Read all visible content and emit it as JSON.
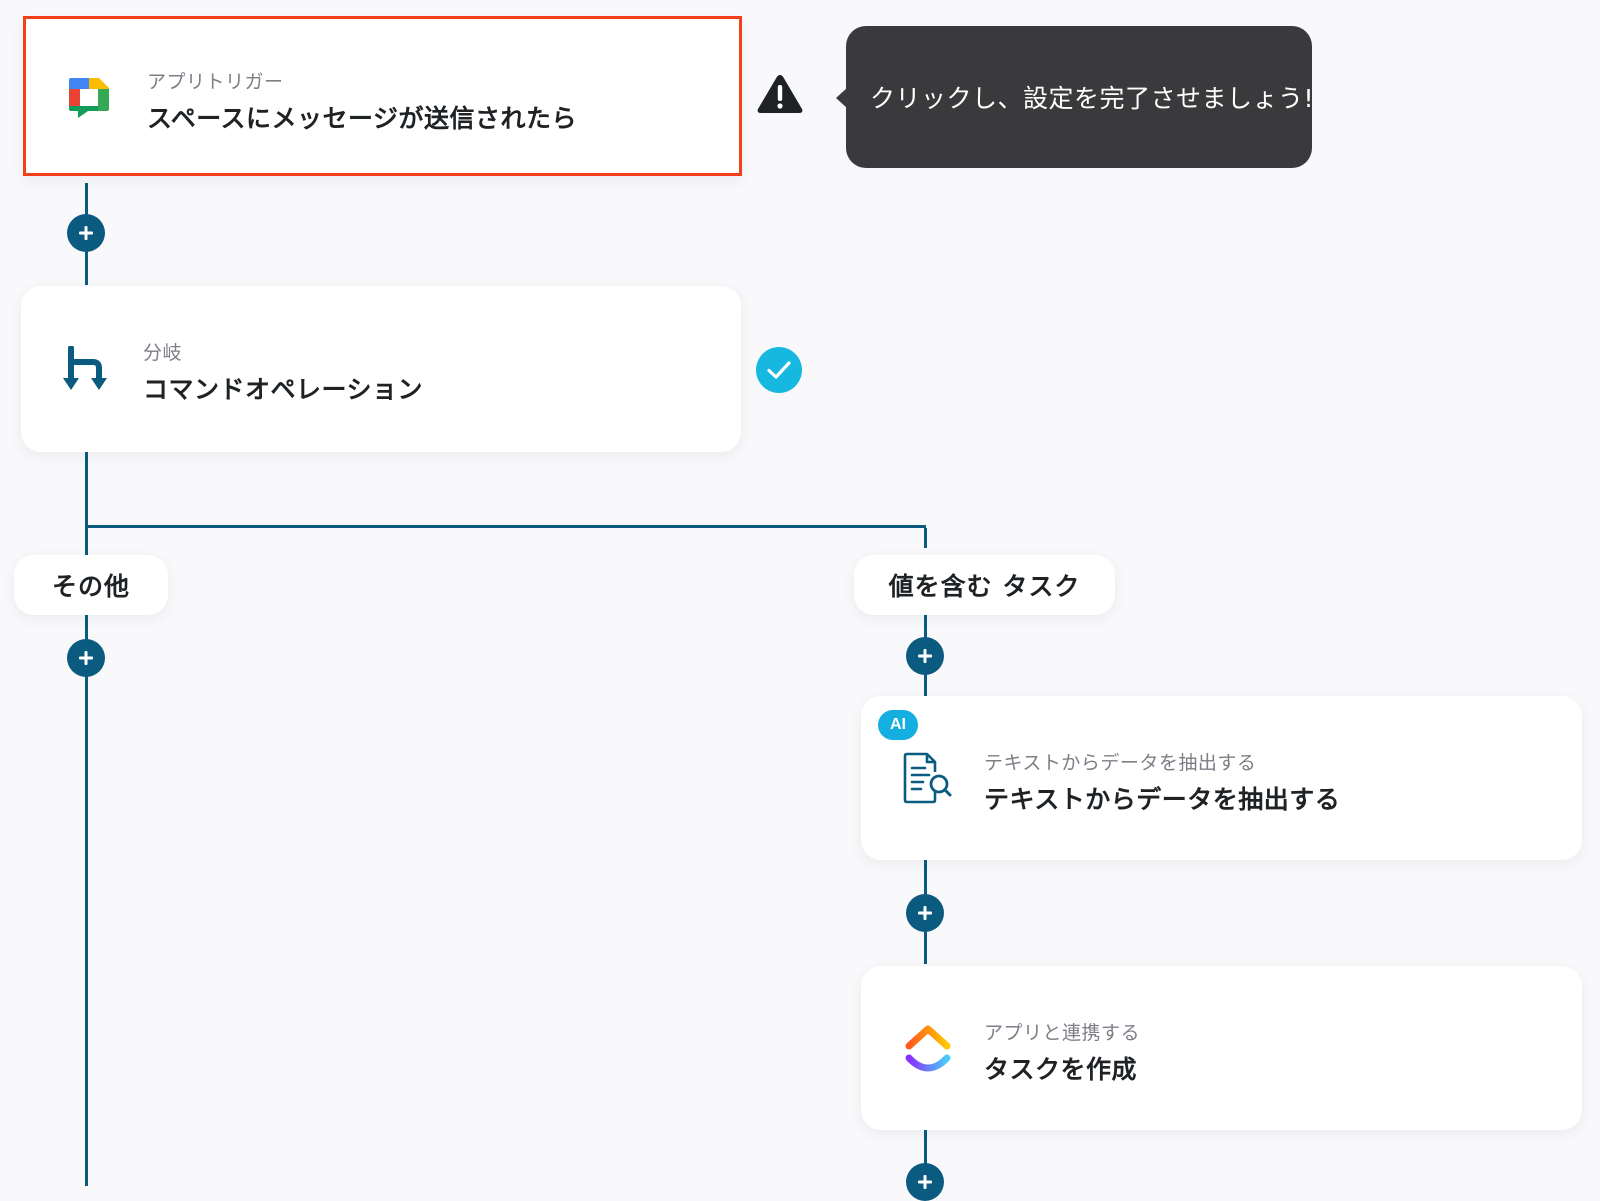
{
  "trigger_card": {
    "subtitle": "アプリトリガー",
    "title": "スペースにメッセージが送信されたら",
    "icon": "google-chat-icon",
    "status": "warning"
  },
  "tooltip": {
    "text": "クリックし、設定を完了させましょう!"
  },
  "branch_card": {
    "subtitle": "分岐",
    "title": "コマンドオペレーション",
    "icon": "branch-icon",
    "status": "complete"
  },
  "branches": [
    {
      "label": "その他"
    },
    {
      "label": "値を含む タスク"
    }
  ],
  "ai_card": {
    "badge": "AI",
    "subtitle": "テキストからデータを抽出する",
    "title": "テキストからデータを抽出する",
    "icon": "document-search-icon"
  },
  "task_card": {
    "subtitle": "アプリと連携する",
    "title": "タスクを作成",
    "icon": "clickup-icon"
  },
  "colors": {
    "connector": "#0b5a80",
    "selected_border": "#f2401c",
    "tooltip_bg": "#3a3a3c",
    "check": "#17b8e0",
    "ai_badge": "#15aee1"
  }
}
